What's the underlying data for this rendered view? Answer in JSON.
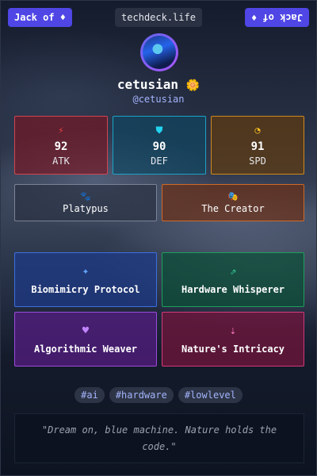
{
  "badges": {
    "left": "Jack of ♦",
    "right": "Jack of ♦"
  },
  "domain": "techdeck.life",
  "profile": {
    "name": "cetusian",
    "name_emoji": "🌼",
    "handle": "@cetusian"
  },
  "stats": [
    {
      "value": "92",
      "label": "ATK",
      "icon": "⚡",
      "icon_name": "lightning-icon",
      "color": "#ef4444"
    },
    {
      "value": "90",
      "label": "DEF",
      "icon": "⛊",
      "icon_name": "shield-icon",
      "color": "#22d3ee"
    },
    {
      "value": "91",
      "label": "SPD",
      "icon": "◔",
      "icon_name": "gauge-icon",
      "color": "#fbbf24"
    }
  ],
  "traits": [
    {
      "label": "Platypus",
      "icon": "🐾",
      "icon_name": "paw-icon",
      "color": "#9ca3af"
    },
    {
      "label": "The Creator",
      "icon": "🎭",
      "icon_name": "masks-icon",
      "color": "#f97316"
    }
  ],
  "skills": [
    {
      "label": "Biomimicry Protocol",
      "icon": "✦",
      "icon_name": "magic-wand-icon",
      "color": "#60a5fa"
    },
    {
      "label": "Hardware Whisperer",
      "icon": "⇗",
      "icon_name": "network-chart-icon",
      "color": "#34d399"
    },
    {
      "label": "Algorithmic Weaver",
      "icon": "♥",
      "icon_name": "heart-icon",
      "color": "#c084fc"
    },
    {
      "label": "Nature's Intricacy",
      "icon": "⇣",
      "icon_name": "sort-descending-icon",
      "color": "#f472b6"
    }
  ],
  "tags": [
    "#ai",
    "#hardware",
    "#lowlevel"
  ],
  "quote": "\"Dream on, blue machine. Nature holds the code.\""
}
